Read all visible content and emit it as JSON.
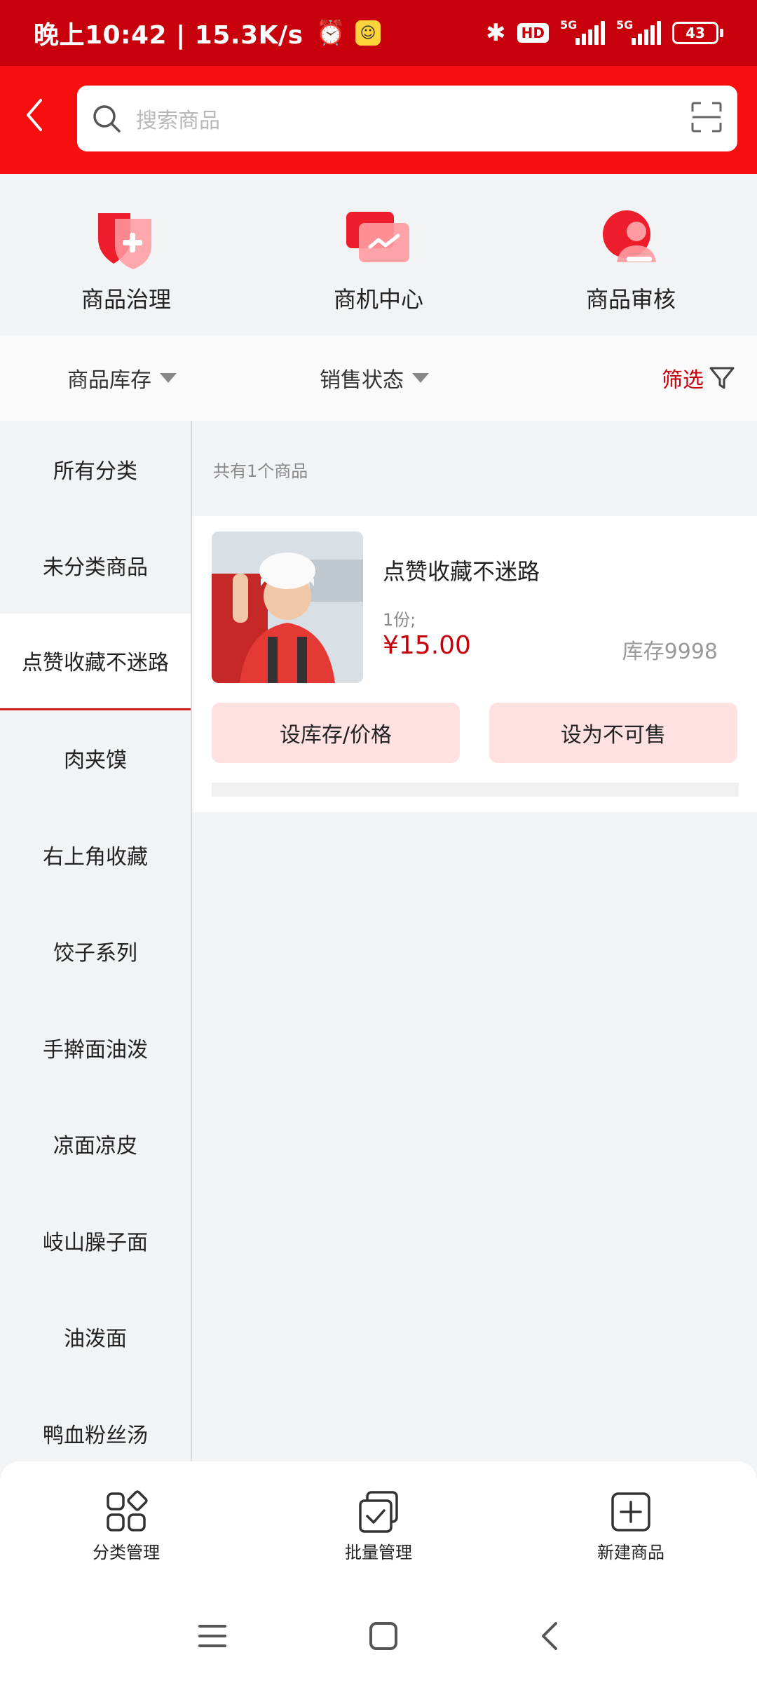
{
  "status_bar": {
    "time": "晚上10:42 | 15.3K/s",
    "alarm_icon": "alarm-icon",
    "app_icon": "app-notification-icon",
    "bluetooth_icon": "bluetooth-icon",
    "hd_label": "HD",
    "signal_1_label": "5G",
    "signal_2_label": "5G",
    "battery": "43"
  },
  "header": {
    "back_icon": "chevron-left-icon",
    "search_placeholder": "搜索商品",
    "scan_icon": "scan-icon"
  },
  "quick_actions": [
    {
      "label": "商品治理",
      "icon": "shield-plus-icon"
    },
    {
      "label": "商机中心",
      "icon": "trend-card-icon"
    },
    {
      "label": "商品审核",
      "icon": "user-minus-icon"
    }
  ],
  "filters": {
    "stock_label": "商品库存",
    "sale_status_label": "销售状态",
    "screen_label": "筛选"
  },
  "sidebar": {
    "categories": [
      "所有分类",
      "未分类商品",
      "点赞收藏不迷路",
      "肉夹馍",
      "右上角收藏",
      "饺子系列",
      "手擀面油泼",
      "凉面凉皮",
      "岐山臊子面",
      "油泼面",
      "鸭血粉丝汤"
    ],
    "active_index": 2
  },
  "content": {
    "count_text": "共有1个商品",
    "product": {
      "name": "点赞收藏不迷路",
      "spec": "1份;",
      "price": "¥15.00",
      "stock": "库存9998",
      "btn_set_stock": "设库存/价格",
      "btn_unsellable": "设为不可售"
    }
  },
  "bottom_bar": {
    "items": [
      {
        "label": "分类管理",
        "icon": "category-grid-icon"
      },
      {
        "label": "批量管理",
        "icon": "batch-check-icon"
      },
      {
        "label": "新建商品",
        "icon": "add-square-icon"
      }
    ]
  },
  "nav_bar": {
    "menu_icon": "menu-icon",
    "home_icon": "home-icon",
    "back_icon": "back-icon"
  },
  "colors": {
    "brand_red": "#f70f0f",
    "status_red": "#c8000b",
    "price_red": "#c8000b",
    "button_pink": "#ffe1e1"
  }
}
